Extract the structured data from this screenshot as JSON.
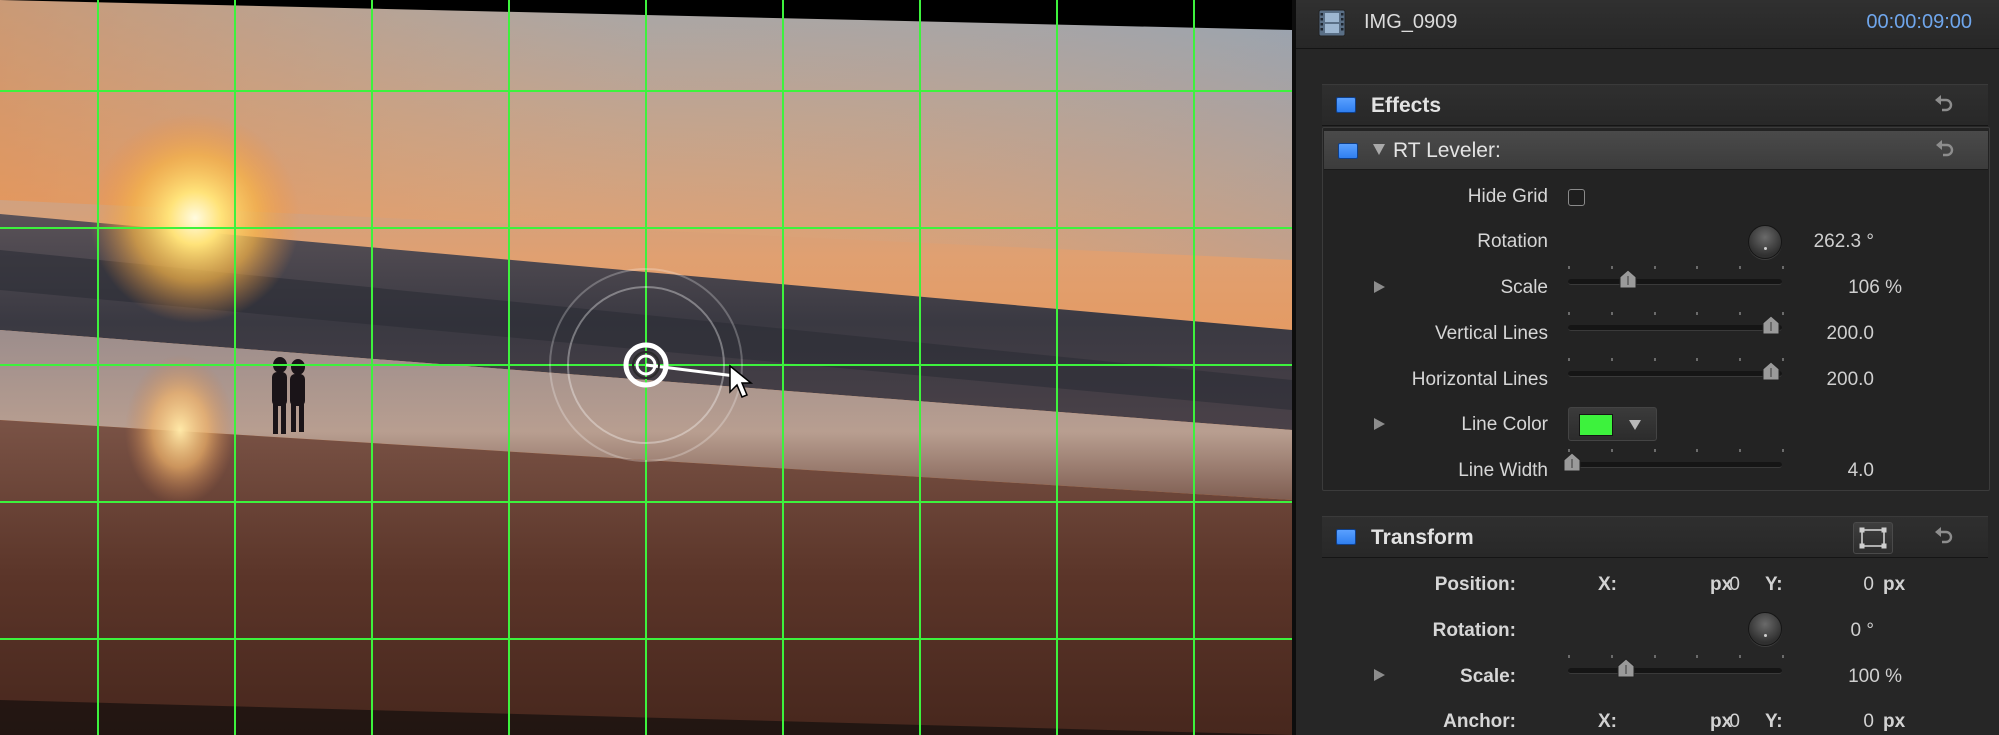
{
  "clip": {
    "name": "IMG_0909",
    "duration": "00:00:09:00"
  },
  "effects_section": {
    "title": "Effects"
  },
  "rt_leveler": {
    "title": "RT Leveler:",
    "hide_grid": {
      "label": "Hide Grid",
      "checked": false
    },
    "rotation": {
      "label": "Rotation",
      "value": "262.3",
      "unit": "°"
    },
    "scale": {
      "label": "Scale",
      "value": "106",
      "unit": "%",
      "fraction": 0.28
    },
    "vertical_lines": {
      "label": "Vertical Lines",
      "value": "200.0",
      "fraction": 0.95
    },
    "horizontal_lines": {
      "label": "Horizontal Lines",
      "value": "200.0",
      "fraction": 0.95
    },
    "line_color": {
      "label": "Line Color",
      "color": "#3df23d"
    },
    "line_width": {
      "label": "Line Width",
      "value": "4.0",
      "fraction": 0.02
    }
  },
  "transform": {
    "title": "Transform",
    "position": {
      "label": "Position:",
      "x_label": "X:",
      "x": "0",
      "x_unit": "px",
      "y_label": "Y:",
      "y": "0",
      "y_unit": "px"
    },
    "rotation": {
      "label": "Rotation:",
      "value": "0",
      "unit": "°"
    },
    "scale": {
      "label": "Scale:",
      "value": "100",
      "unit": "%",
      "fraction": 0.27
    },
    "anchor": {
      "label": "Anchor:",
      "x_label": "X:",
      "x": "0",
      "x_unit": "px",
      "y_label": "Y:",
      "y": "0",
      "y_unit": "px"
    }
  },
  "icons": {
    "clip": "film-strip-icon",
    "reset": "reset-arrow-icon",
    "section_enable": "blue-checkbox-icon",
    "transform_onscreen": "transform-frame-icon"
  },
  "colors": {
    "grid": "#3df23d",
    "accent_blue": "#2f7ff0",
    "timecode": "#6fa6ec"
  }
}
